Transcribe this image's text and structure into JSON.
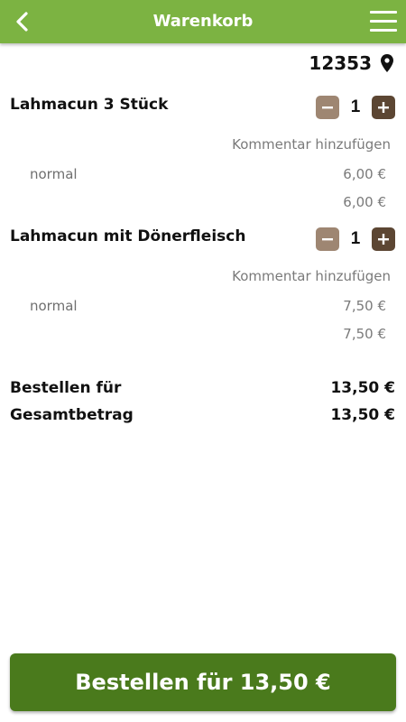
{
  "header": {
    "title": "Warenkorb",
    "back_icon": "chevron-left-icon",
    "menu_icon": "hamburger-menu-icon",
    "bar_color": "#7cb342"
  },
  "location": {
    "postcode": "12353",
    "icon": "map-pin-icon"
  },
  "cart": {
    "items": [
      {
        "name": "Lahmacun 3 Stück",
        "quantity": "1",
        "comment_label": "Kommentar hinzufügen",
        "variant": "normal",
        "variant_price": "6,00 €",
        "item_total": "6,00 €"
      },
      {
        "name": "Lahmacun mit Dönerfleisch",
        "quantity": "1",
        "comment_label": "Kommentar hinzufügen",
        "variant": "normal",
        "variant_price": "7,50 €",
        "item_total": "7,50 €"
      }
    ]
  },
  "summary": {
    "order_for_label": "Bestellen für",
    "order_for_value": "13,50 €",
    "total_label": "Gesamtbetrag",
    "total_value": "13,50 €"
  },
  "order_button": {
    "label": "Bestellen für 13,50 €",
    "color": "#4a7a1c"
  },
  "colors": {
    "minus_button": "#9e8672",
    "plus_button": "#5c4633"
  }
}
